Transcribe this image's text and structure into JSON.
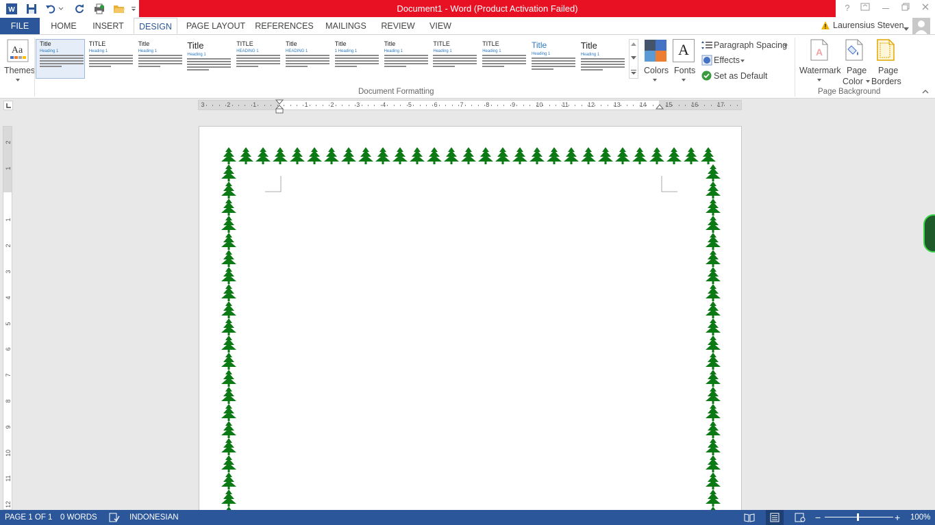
{
  "window": {
    "title": "Document1 -  Word (Product Activation Failed)",
    "controls": [
      "?",
      "restore-ribbon",
      "minimize",
      "restore",
      "close"
    ]
  },
  "tabs": [
    "FILE",
    "HOME",
    "INSERT",
    "DESIGN",
    "PAGE LAYOUT",
    "REFERENCES",
    "MAILINGS",
    "REVIEW",
    "VIEW"
  ],
  "active_tab": "DESIGN",
  "user": {
    "name": "Laurensius Steven"
  },
  "ribbon": {
    "themes_label": "Themes",
    "colors_label": "Colors",
    "fonts_label": "Fonts",
    "paragraph_spacing_label": "Paragraph Spacing",
    "effects_label": "Effects",
    "set_default_label": "Set as Default",
    "watermark_label": "Watermark",
    "page_color_label1": "Page",
    "page_color_label2": "Color",
    "page_borders_label1": "Page",
    "page_borders_label2": "Borders",
    "group_document_formatting": "Document Formatting",
    "group_page_background": "Page Background",
    "style_thumbs": [
      {
        "title": "Title",
        "heading": "Heading 1"
      },
      {
        "title": "TITLE",
        "heading": "Heading 1"
      },
      {
        "title": "Title",
        "heading": "Heading 1"
      },
      {
        "title": "Title",
        "heading": "Heading 1"
      },
      {
        "title": "TITLE",
        "heading": "HEADING 1"
      },
      {
        "title": "Title",
        "heading": "HEADING 1"
      },
      {
        "title": "Title",
        "heading": "1   Heading 1"
      },
      {
        "title": "Title",
        "heading": "Heading 1"
      },
      {
        "title": "TITLE",
        "heading": "Heading 1"
      },
      {
        "title": "TITLE",
        "heading": "Heading 1"
      },
      {
        "title": "Title",
        "heading": "Heading 1"
      },
      {
        "title": "Title",
        "heading": "Heading 1"
      }
    ]
  },
  "ruler": {
    "horizontal": [
      "3",
      "2",
      "1",
      "",
      "1",
      "2",
      "3",
      "4",
      "5",
      "6",
      "7",
      "8",
      "9",
      "10",
      "11",
      "12",
      "13",
      "14",
      "15",
      "16",
      "17"
    ],
    "vertical": [
      "2",
      "1",
      "",
      "1",
      "2",
      "3",
      "4",
      "5",
      "6",
      "7",
      "8",
      "9",
      "10",
      "11",
      "12"
    ]
  },
  "status": {
    "page": "PAGE 1 OF 1",
    "words": "0 WORDS",
    "language": "INDONESIAN",
    "zoom": "100%",
    "zoom_minus": "−",
    "zoom_plus": "+"
  },
  "colors": {
    "accent": "#2b579a",
    "titlebar_red": "#e81123",
    "tree_green": "#0b7a14"
  }
}
